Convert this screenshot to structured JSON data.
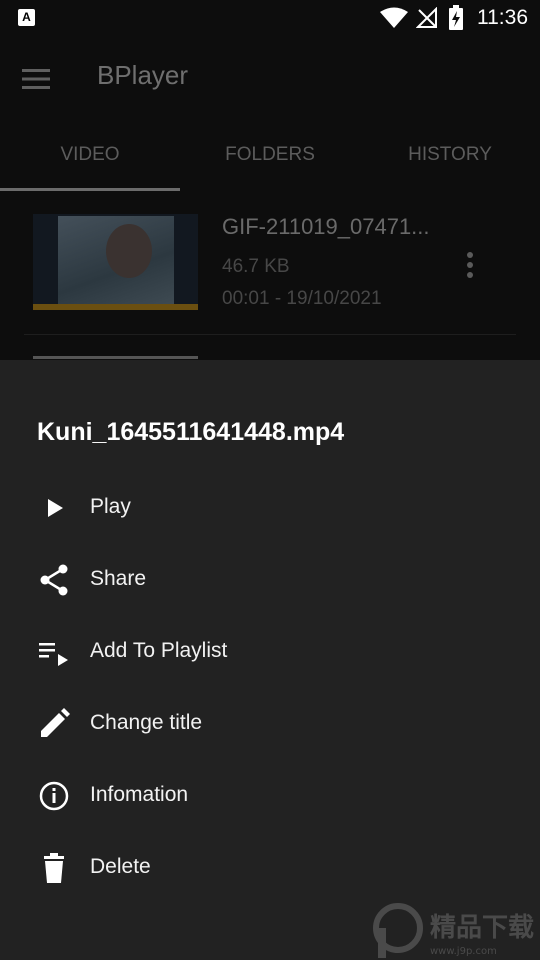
{
  "status_bar": {
    "time": "11:36",
    "notif_letter": "A"
  },
  "app_bar": {
    "title": "BPlayer"
  },
  "tabs": [
    {
      "label": "VIDEO"
    },
    {
      "label": "FOLDERS"
    },
    {
      "label": "HISTORY"
    }
  ],
  "video": {
    "title": "GIF-211019_07471...",
    "size": "46.7 KB",
    "meta": "00:01 - 19/10/2021"
  },
  "sheet": {
    "title": "Kuni_1645511641448.mp4",
    "items": [
      {
        "label": "Play",
        "icon": "play-icon"
      },
      {
        "label": "Share",
        "icon": "share-icon"
      },
      {
        "label": "Add To Playlist",
        "icon": "playlist-add-icon"
      },
      {
        "label": "Change title",
        "icon": "pencil-icon"
      },
      {
        "label": "Infomation",
        "icon": "info-icon"
      },
      {
        "label": "Delete",
        "icon": "trash-icon"
      }
    ]
  },
  "watermark": {
    "text": "精品下载",
    "url": "www.j9p.com"
  }
}
